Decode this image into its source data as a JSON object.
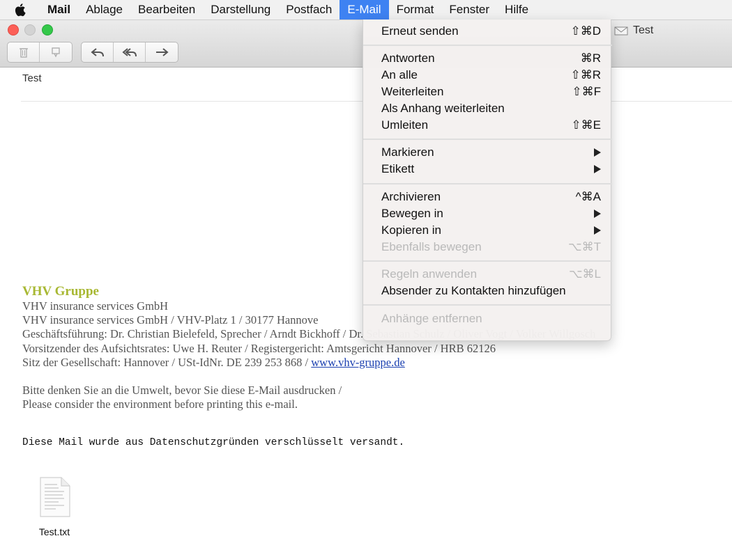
{
  "menubar": {
    "app": "Mail",
    "items": [
      "Ablage",
      "Bearbeiten",
      "Darstellung",
      "Postfach",
      "E-Mail",
      "Format",
      "Fenster",
      "Hilfe"
    ],
    "active": "E-Mail"
  },
  "window": {
    "title": "Test"
  },
  "mail": {
    "subject_fragment": "Test",
    "signature": {
      "brand": "VHV Gruppe",
      "line1": "VHV insurance services GmbH",
      "line2": "VHV insurance services GmbH / VHV-Platz 1 / 30177 Hannove",
      "line3": "Geschäftsführung: Dr. Christian Bielefeld, Sprecher / Arndt Bickhoff / Dr. Sebastian Schulz / Oliver Vogt / Volker Willgosch",
      "line4": "Vorsitzender des Aufsichtsrates: Uwe H. Reuter / Registergericht: Amtsgericht Hannover / HRB 62126",
      "line5_prefix": "Sitz der Gesellschaft: Hannover / USt-IdNr. DE 239 253 868 / ",
      "link": "www.vhv-gruppe.de",
      "env_de": "Bitte denken Sie an die Umwelt, bevor Sie diese E-Mail ausdrucken /",
      "env_en": "Please consider the environment before printing this e-mail."
    },
    "encrypted_note": "Diese Mail wurde aus Datenschutzgründen verschlüsselt versandt.",
    "attachment": "Test.txt"
  },
  "dropdown": {
    "items": [
      {
        "label": "Erneut senden",
        "shortcut": "⇧⌘D"
      },
      {
        "label": "Antworten",
        "shortcut": "⌘R"
      },
      {
        "label": "An alle",
        "shortcut": "⇧⌘R"
      },
      {
        "label": "Weiterleiten",
        "shortcut": "⇧⌘F"
      },
      {
        "label": "Als Anhang weiterleiten",
        "shortcut": ""
      },
      {
        "label": "Umleiten",
        "shortcut": "⇧⌘E"
      },
      {
        "label": "Markieren",
        "shortcut": ""
      },
      {
        "label": "Etikett",
        "shortcut": ""
      },
      {
        "label": "Archivieren",
        "shortcut": "^⌘A"
      },
      {
        "label": "Bewegen in",
        "shortcut": ""
      },
      {
        "label": "Kopieren in",
        "shortcut": ""
      },
      {
        "label": "Ebenfalls bewegen",
        "shortcut": "⌥⌘T"
      },
      {
        "label": "Regeln anwenden",
        "shortcut": "⌥⌘L"
      },
      {
        "label": "Absender zu Kontakten hinzufügen",
        "shortcut": ""
      },
      {
        "label": "Anhänge entfernen",
        "shortcut": ""
      }
    ]
  },
  "colors": {
    "menu_highlight": "#3e82f2",
    "brand_green": "#a8b833",
    "link_blue": "#1a3fb0",
    "disabled_text": "#b9b9b9"
  }
}
